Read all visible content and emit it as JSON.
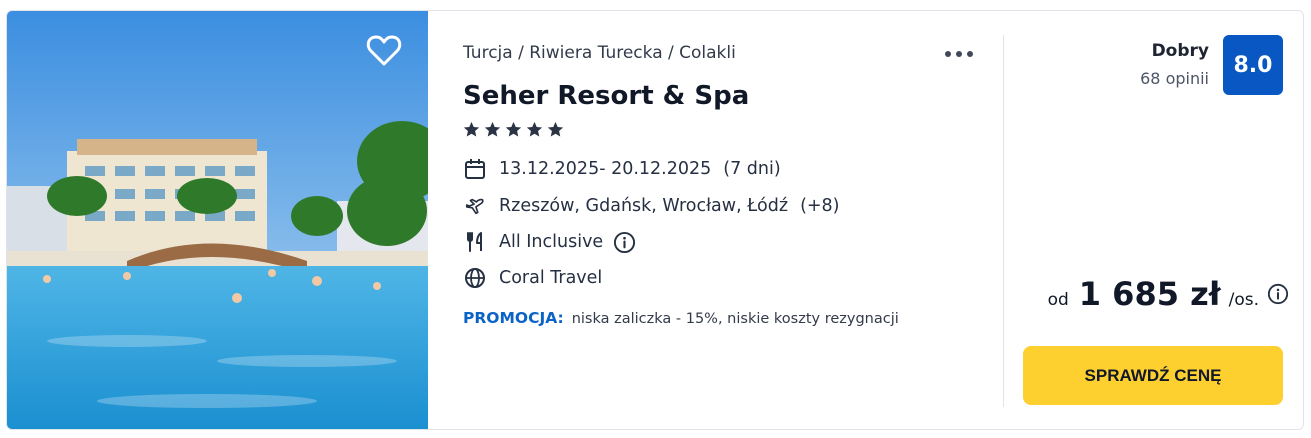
{
  "hotel": {
    "breadcrumb": "Turcja / Riwiera Turecka / Colakli",
    "name": "Seher Resort & Spa",
    "stars": 5,
    "dates": "13.12.2025- 20.12.2025",
    "duration": "(7 dni)",
    "departures": "Rzeszów, Gdańsk, Wrocław, Łódź",
    "departures_more": "(+8)",
    "board": "All Inclusive",
    "operator": "Coral Travel",
    "promo_label": "PROMOCJA:",
    "promo_text": "niska zaliczka - 15%, niskie koszty rezygnacji"
  },
  "rating": {
    "label": "Dobry",
    "count": "68 opinii",
    "score": "8.0"
  },
  "price": {
    "prefix": "od",
    "amount": "1 685 zł",
    "suffix": "/os."
  },
  "cta_label": "SPRAWDŹ CENĘ",
  "icons": {
    "favorite": "heart-icon",
    "more": "more-dots-icon",
    "calendar": "calendar-icon",
    "flight": "plane-icon",
    "board": "cutlery-icon",
    "operator": "globe-icon",
    "info": "info-icon"
  },
  "colors": {
    "score_bg": "#0857c3",
    "promo": "#0b63c7",
    "cta_bg": "#fed02f"
  }
}
